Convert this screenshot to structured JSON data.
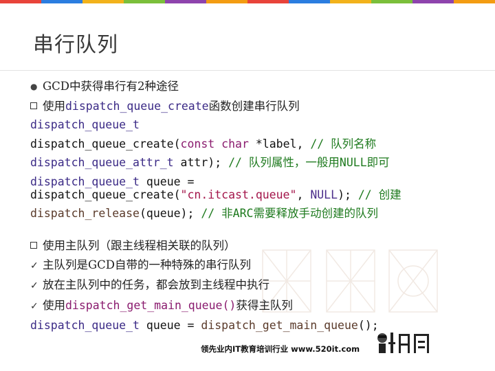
{
  "colors": [
    "#e8433a",
    "#2b7de0",
    "#f2b21b",
    "#7bbf3b",
    "#8e44ad",
    "#f39c12",
    "#e8433a",
    "#2b7de0",
    "#f2b21b",
    "#7bbf3b",
    "#8e44ad",
    "#f39c12"
  ],
  "title": "串行队列",
  "lines": {
    "l1": "GCD中获得串行有2种途径",
    "l2_a": "使用",
    "l2_b": "dispatch_queue_create",
    "l2_c": "函数创建串行队列",
    "l3": "dispatch_queue_t",
    "l4_a": "dispatch_queue_create(",
    "l4_b": "const",
    "l4_c": "char",
    "l4_d": "*label,",
    "l4_e": "// 队列名称",
    "l5_a": "dispatch_queue_attr_t",
    "l5_b": " attr);",
    "l5_c": " // 队列属性，一般用NULL即可",
    "l6_a": "dispatch_queue_t",
    "l6_b": " queue =",
    "l7_a": "dispatch_queue_create(",
    "l7_b": "\"cn.itcast.queue\"",
    "l7_c": ", ",
    "l7_d": "NULL",
    "l7_e": ");",
    "l7_f": " // 创建",
    "l8_a": "dispatch_release",
    "l8_b": "(queue);",
    "l8_c": " // 非ARC需要释放手动创建的队列",
    "l9": "使用主队列（跟主线程相关联的队列）",
    "l10": "主队列是GCD自带的一种特殊的串行队列",
    "l11": "放在主队列中的任务，都会放到主线程中执行",
    "l12_a": "使用",
    "l12_b": "dispatch_get_main_queue()",
    "l12_c": "获得主队列",
    "l13_a": "dispatch_queue_t",
    "l13_b": " queue = ",
    "l13_c": "dispatch_get_main_queue",
    "l13_d": "();"
  },
  "footer": "领先业内IT教育培训行业 www.520it.com",
  "logo": "小码哥"
}
